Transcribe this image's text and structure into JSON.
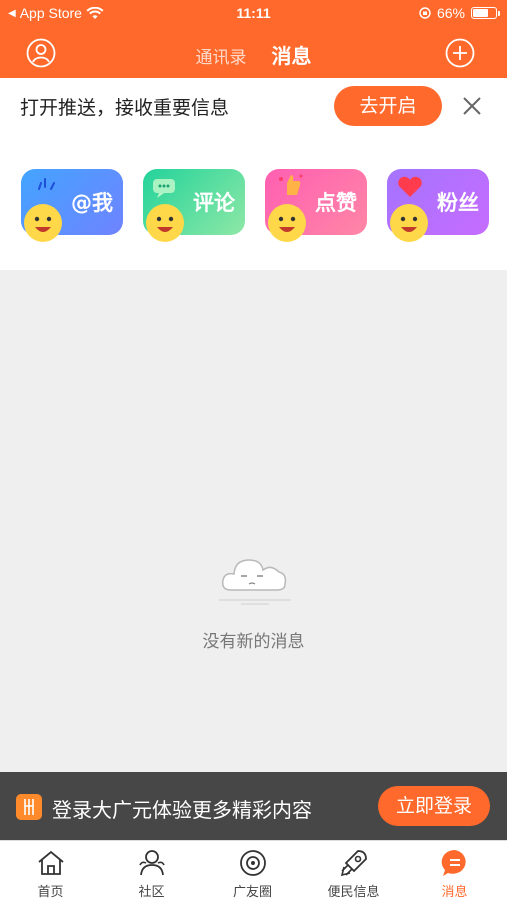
{
  "status_bar": {
    "back_app": "App Store",
    "time": "11:11",
    "battery": "66%",
    "battery_level": 0.66
  },
  "nav": {
    "tab_contacts": "通讯录",
    "tab_messages": "消息"
  },
  "push_banner": {
    "text": "打开推送，接收重要信息",
    "button": "去开启"
  },
  "categories": [
    {
      "label": "@我",
      "icon": "at-me-icon"
    },
    {
      "label": "评论",
      "icon": "comment-icon"
    },
    {
      "label": "点赞",
      "icon": "like-icon"
    },
    {
      "label": "粉丝",
      "icon": "fans-icon"
    }
  ],
  "empty_state": {
    "message": "没有新的消息"
  },
  "login_bar": {
    "text": "登录大广元体验更多精彩内容",
    "button": "立即登录"
  },
  "tab_bar": [
    {
      "label": "首页",
      "icon": "home-icon"
    },
    {
      "label": "社区",
      "icon": "community-icon"
    },
    {
      "label": "广友圈",
      "icon": "circle-icon"
    },
    {
      "label": "便民信息",
      "icon": "rocket-icon"
    },
    {
      "label": "消息",
      "icon": "message-icon",
      "active": true
    }
  ],
  "colors": {
    "accent": "#ff6a2c",
    "login_bar_bg": "#474747",
    "background": "#efefef"
  }
}
